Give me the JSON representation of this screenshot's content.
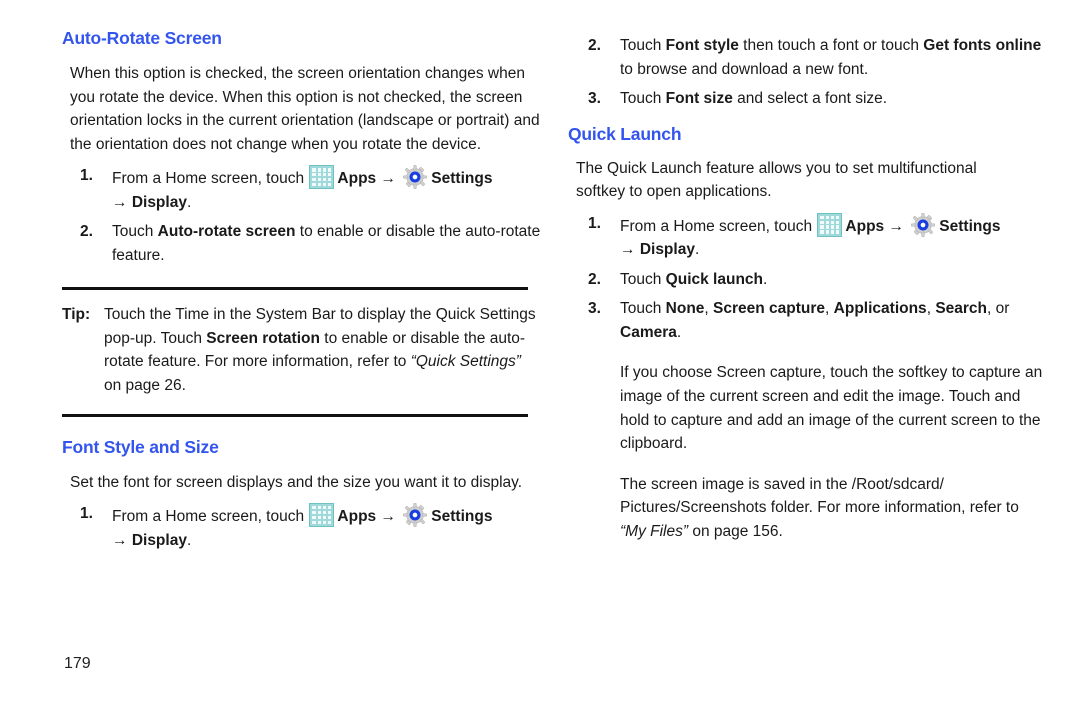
{
  "meta": {
    "page_number": "179",
    "heading_color": "#3355ee",
    "body_color": "#1a1a1a",
    "apps_icon_color": "#9fd9d9",
    "gear_icon_ring_color": "#1a3fe0"
  },
  "icons": {
    "apps": "apps-grid-icon",
    "settings": "settings-gear-icon",
    "arrow": "→"
  },
  "left_column": {
    "section1": {
      "heading": "Auto-Rotate Screen",
      "intro": "When this option is checked, the screen orientation changes when you rotate the device. When this option is not checked, the screen orientation locks in the current orientation (landscape or portrait) and the orientation does not change when you rotate the device.",
      "steps": [
        {
          "num": "1.",
          "pre_apps": "From a Home screen, touch ",
          "apps_label": "Apps",
          "settings_label": "Settings",
          "sub_arrow": "→",
          "sub_label": "Display",
          "sub_period": "."
        },
        {
          "num": "2.",
          "text_pre": "Touch ",
          "text_bold": "Auto-rotate screen",
          "text_post": " to enable or disable the auto-rotate feature."
        }
      ]
    },
    "tip": {
      "label": "Tip:",
      "part1": " Touch the Time in the System Bar to display the Quick Settings pop-up. Touch ",
      "bold1": "Screen rotation",
      "part2": " to enable or disable the auto-rotate feature. For more information, refer to ",
      "italic_ref": "“Quick Settings”",
      "part3": "  on page 26."
    },
    "section2": {
      "heading": "Font Style and Size",
      "intro": "Set the font for screen displays and the size you want it to display.",
      "steps": [
        {
          "num": "1.",
          "pre_apps": "From a Home screen, touch ",
          "apps_label": "Apps",
          "settings_label": "Settings",
          "sub_arrow": "→",
          "sub_label": "Display",
          "sub_period": "."
        }
      ]
    }
  },
  "right_column": {
    "continued_steps": [
      {
        "num": "2.",
        "t1": "Touch ",
        "b1": "Font style",
        "t2": " then touch a font or touch ",
        "b2": "Get fonts online",
        "t3": " to browse and download a new font."
      },
      {
        "num": "3.",
        "t1": "Touch ",
        "b1": "Font size",
        "t2": " and select a font size.",
        "b2": "",
        "t3": ""
      }
    ],
    "section3": {
      "heading": "Quick Launch",
      "intro": "The Quick Launch feature allows you to set multifunctional softkey to open applications.",
      "steps": [
        {
          "num": "1.",
          "pre_apps": "From a Home screen, touch ",
          "apps_label": "Apps",
          "settings_label": "Settings",
          "sub_arrow": "→",
          "sub_label": "Display",
          "sub_period": "."
        },
        {
          "num": "2.",
          "t1": "Touch ",
          "b1": "Quick launch",
          "t2": "."
        },
        {
          "num": "3.",
          "t1": "Touch ",
          "b1": "None",
          "t2": ", ",
          "b2": "Screen capture",
          "t3": ", ",
          "b3": "Applications",
          "t4": ", ",
          "b4": "Search",
          "t5": ", or ",
          "b5": "Camera",
          "t6": "."
        }
      ],
      "para1": "If you choose Screen capture, touch the softkey to capture an image of the current screen and edit the image. Touch and hold to capture and add an image of the current screen to the clipboard.",
      "para2_pre": "The screen image is saved in the /Root/sdcard/ Pictures/Screenshots folder. For more information, refer to ",
      "para2_italic": "“My Files”",
      "para2_post": "  on page 156."
    }
  }
}
